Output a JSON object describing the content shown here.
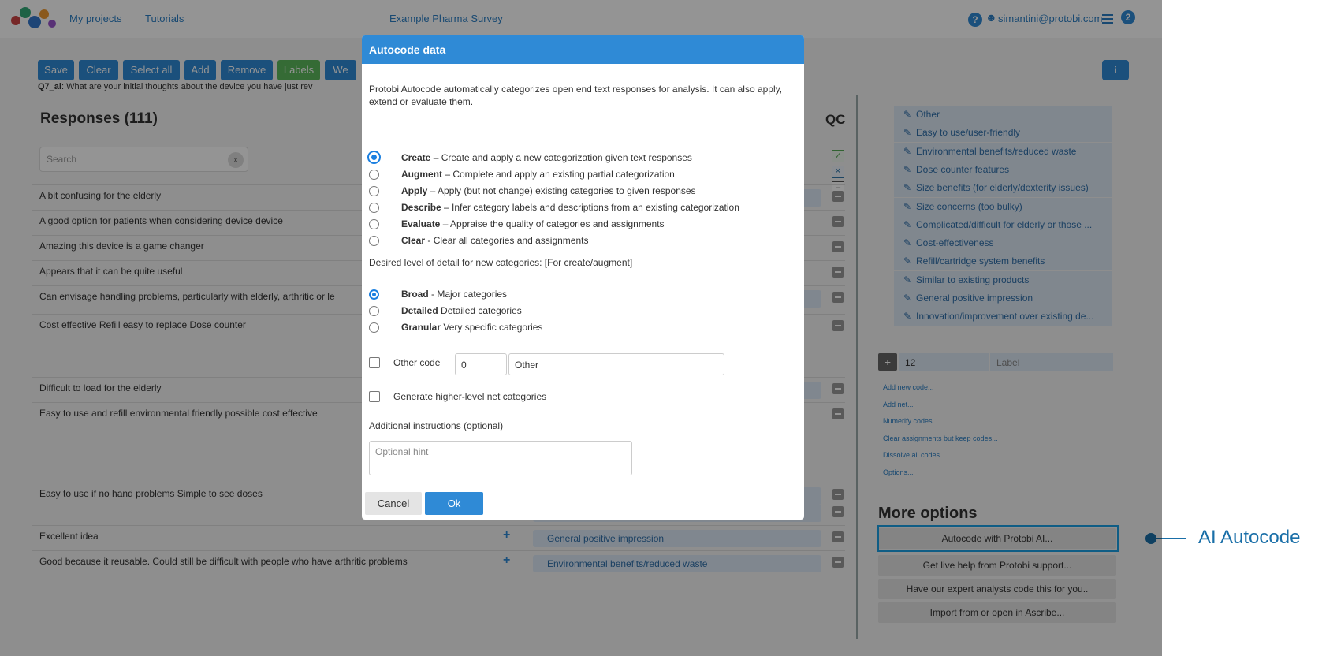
{
  "header": {
    "nav": [
      "My projects",
      "Tutorials"
    ],
    "project_title": "Example Pharma Survey",
    "help_icon": "?",
    "user_email": "simantini@protobi.com",
    "menu_icon": "hamburger-icon",
    "notification_count": "2"
  },
  "toolbar": {
    "buttons": [
      "Save",
      "Clear",
      "Select all",
      "Add",
      "Remove",
      "Labels",
      "We"
    ],
    "info_icon": "i"
  },
  "question": {
    "id": "Q7_ai",
    "text": "What are your initial thoughts about the device you have just rev"
  },
  "responses": {
    "heading": "Responses (111)",
    "qc_heading": "QC",
    "search_placeholder": "Search",
    "search_clear": "x",
    "rows": [
      {
        "text": "A bit confusing for the elderly",
        "codes": [
          "s..."
        ]
      },
      {
        "text": "A good option for patients when considering device device",
        "codes": []
      },
      {
        "text": "Amazing this device is a game changer",
        "codes": []
      },
      {
        "text": "Appears that it can be quite useful",
        "codes": []
      },
      {
        "text": "Can envisage handling problems, particularly with elderly, arthritic or le",
        "codes": [
          "s..."
        ]
      },
      {
        "text": "Cost effective Refill easy to replace Dose counter",
        "codes": []
      },
      {
        "text": "Difficult to load for the elderly",
        "codes": [
          "s..."
        ]
      },
      {
        "text": "Easy to use and refill environmental friendly possible cost effective",
        "codes": []
      },
      {
        "text": "Easy to use if no hand problems Simple to see doses",
        "codes": [
          "Easy to use/user-friendly",
          "Dose counter features"
        ]
      },
      {
        "text": "Excellent idea",
        "codes": [
          "General positive impression"
        ]
      },
      {
        "text": "Good because it reusable. Could still be difficult with people who have arthritic problems",
        "codes": [
          "Environmental benefits/reduced waste"
        ]
      }
    ]
  },
  "codebook": {
    "codes": [
      "Other",
      "Easy to use/user-friendly",
      "Environmental benefits/reduced waste",
      "Dose counter features",
      "Size benefits (for elderly/dexterity issues)",
      "Size concerns (too bulky)",
      "Complicated/difficult for elderly or those ...",
      "Cost-effectiveness",
      "Refill/cartridge system benefits",
      "Similar to existing products",
      "General positive impression",
      "Innovation/improvement over existing de..."
    ],
    "new_code_value": "12",
    "new_code_placeholder": "Label",
    "add_button": "+",
    "links": [
      "Add new code...",
      "Add net...",
      "Numerify codes...",
      "Clear assignments but keep codes...",
      "Dissolve all codes...",
      "Options..."
    ]
  },
  "more_options": {
    "heading": "More options",
    "buttons": [
      "Autocode with Protobi AI...",
      "Get live help from Protobi support...",
      "Have our expert analysts code this for you..",
      "Import from or open in Ascribe..."
    ]
  },
  "callout": {
    "label": "AI Autocode"
  },
  "modal": {
    "title": "Autocode data",
    "intro": "Protobi Autocode automatically categorizes open end text responses for analysis. It can also apply, extend or evaluate them.",
    "modes": [
      {
        "name": "Create",
        "desc": " – Create and apply a new categorization given text responses",
        "selected": true
      },
      {
        "name": "Augment",
        "desc": " – Complete and apply an existing partial categorization",
        "selected": false
      },
      {
        "name": "Apply",
        "desc": " – Apply (but not change) existing categories to given responses",
        "selected": false
      },
      {
        "name": "Describe",
        "desc": " – Infer category labels and descriptions from an existing categorization",
        "selected": false
      },
      {
        "name": "Evaluate",
        "desc": " – Appraise the quality of categories and assignments",
        "selected": false
      },
      {
        "name": "Clear",
        "desc": " - Clear all categories and assignments",
        "selected": false
      }
    ],
    "detail_label": "Desired level of detail for new categories: [For create/augment]",
    "details": [
      {
        "name": "Broad",
        "desc": " - Major categories",
        "selected": true
      },
      {
        "name": "Detailed",
        "desc": " Detailed categories",
        "selected": false
      },
      {
        "name": "Granular",
        "desc": " Very specific categories",
        "selected": false
      }
    ],
    "other_code_label": "Other code",
    "other_code_value": "0",
    "other_code_text": "Other",
    "net_label": "Generate higher-level net categories",
    "instructions_label": "Additional instructions (optional)",
    "hint_placeholder": "Optional hint",
    "cancel_label": "Cancel",
    "ok_label": "Ok"
  },
  "colors": {
    "primary": "#2f8ad6",
    "labels_button": "#5cb85c",
    "callout": "#1a6fa8",
    "highlight": "#1aa0e6"
  }
}
